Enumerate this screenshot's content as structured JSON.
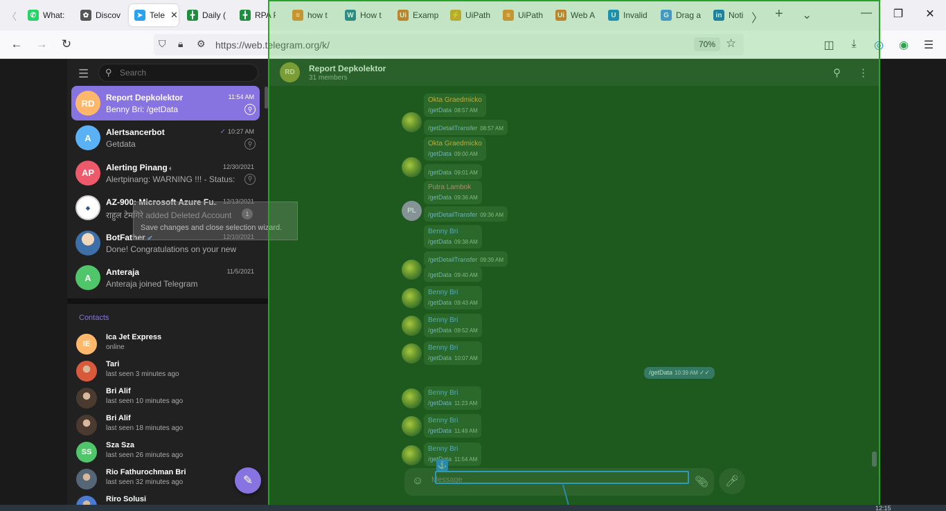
{
  "browser": {
    "tabs": [
      {
        "label": "What:",
        "icon": "whatsapp-icon",
        "color": "#25d366",
        "glyph": "✆"
      },
      {
        "label": "Discov",
        "icon": "discover-icon",
        "color": "#555555",
        "glyph": "✿"
      },
      {
        "label": "Tele",
        "icon": "telegram-icon",
        "color": "#2aa3ef",
        "glyph": "➤",
        "active": true
      },
      {
        "label": "Daily (",
        "icon": "sheets-icon",
        "color": "#1e8e3e",
        "glyph": "╋"
      },
      {
        "label": "RPA P",
        "icon": "sheets-icon",
        "color": "#1e8e3e",
        "glyph": "╋"
      },
      {
        "label": "how t",
        "icon": "stackoverflow-icon",
        "color": "#f48024",
        "glyph": "≡"
      },
      {
        "label": "How t",
        "icon": "wordpress-icon",
        "color": "#21759b",
        "glyph": "W"
      },
      {
        "label": "Examp",
        "icon": "uipath-icon",
        "color": "#e86a1f",
        "glyph": "Ui"
      },
      {
        "label": "UiPath",
        "icon": "uipath-forum-icon",
        "color": "#e0a020",
        "glyph": "⚡"
      },
      {
        "label": "UiPath",
        "icon": "stackoverflow-icon",
        "color": "#f48024",
        "glyph": "≡"
      },
      {
        "label": "Web A",
        "icon": "uipath-icon",
        "color": "#e86a1f",
        "glyph": "Ui"
      },
      {
        "label": "Invalid",
        "icon": "uipath-docs-icon",
        "color": "#0a7bd6",
        "glyph": "U"
      },
      {
        "label": "Drag a",
        "icon": "google-icon",
        "color": "#4285f4",
        "glyph": "G"
      },
      {
        "label": "Noti",
        "icon": "linkedin-icon",
        "color": "#0a66c2",
        "glyph": "in"
      }
    ],
    "url": "https://web.telegram.org/k/",
    "zoom": "70%"
  },
  "sidebar": {
    "search_placeholder": "Search",
    "chats": [
      {
        "initials": "RD",
        "name": "Report Depkolektor",
        "time": "11:54 AM",
        "preview": "Benny Bri: /getData",
        "color": "#ffb86b",
        "active": true,
        "indicator": "pin"
      },
      {
        "initials": "A",
        "name": "Alertsancerbot",
        "time": "10:27 AM",
        "preview": "Getdata",
        "color": "#5bb1f5",
        "indicator": "pin",
        "read": true
      },
      {
        "initials": "AP",
        "name": "Alerting Pinang",
        "time": "12/30/2021",
        "preview": "Alertpinang: WARNING !!! - Status: PA...",
        "color": "#ec5a6b",
        "indicator": "pin",
        "muted": true
      },
      {
        "initials": "",
        "name": "AZ-900: Microsoft Azure Fu...",
        "time": "12/13/2021",
        "preview": "राहुल टेमगिरे added Deleted Account",
        "color": "#ffffff",
        "indicator": "badge",
        "unread": "1",
        "muted": true
      },
      {
        "initials": "",
        "name": "BotFather",
        "time": "12/10/2021",
        "preview": "Done! Congratulations on your new bot. Y...",
        "color": "#3d6fa8",
        "verified": true
      },
      {
        "initials": "A",
        "name": "Anteraja",
        "time": "11/5/2021",
        "preview": "Anteraja joined Telegram",
        "color": "#50c56a"
      }
    ],
    "contacts_title": "Contacts",
    "contacts": [
      {
        "initials": "IE",
        "name": "Ica Jet Express",
        "status": "online",
        "color": "#ffb86b"
      },
      {
        "initials": "",
        "name": "Tari",
        "status": "last seen 3 minutes ago",
        "color": "#d85a3a"
      },
      {
        "initials": "",
        "name": "Bri Alif",
        "status": "last seen 10 minutes ago",
        "color": "#4a3a30"
      },
      {
        "initials": "",
        "name": "Bri Alif",
        "status": "last seen 18 minutes ago",
        "color": "#4a3a30"
      },
      {
        "initials": "SS",
        "name": "Sza Sza",
        "status": "last seen 26 minutes ago",
        "color": "#50c56a"
      },
      {
        "initials": "",
        "name": "Rio Fathurochman Bri",
        "status": "last seen 32 minutes ago",
        "color": "#556677"
      },
      {
        "initials": "",
        "name": "Riro Solusi",
        "status": "",
        "color": "#4a7bd0"
      }
    ]
  },
  "tooltip": {
    "text": "Save changes and close selection wizard."
  },
  "chat": {
    "title": "Report Depkolektor",
    "subtitle": "31 members",
    "avatar_initials": "RD",
    "composer_placeholder": "Message",
    "colors": {
      "sender_okta": "#e6a23a",
      "sender_putra": "#c97a7a",
      "sender_benny": "#5aa0d8",
      "link": "#7ea8d8"
    },
    "messages": [
      {
        "kind": "in",
        "sender": "Okta Graedmicko",
        "sender_color": "#e6a23a",
        "text": "/getData",
        "time": "08:57 AM"
      },
      {
        "kind": "in",
        "text": "/getDetailTransfer",
        "time": "08:57 AM"
      },
      {
        "kind": "in",
        "sender": "Okta Graedmicko",
        "sender_color": "#e6a23a",
        "text": "/getData",
        "time": "09:00 AM"
      },
      {
        "kind": "in",
        "text": "/getData",
        "time": "09:01 AM"
      },
      {
        "kind": "in",
        "sender": "Putra Lambok",
        "sender_color": "#c97a7a",
        "text": "/getData",
        "time": "09:36 AM"
      },
      {
        "kind": "in",
        "text": "/getDetailTransfer",
        "time": "09:36 AM",
        "avatar": "PL"
      },
      {
        "kind": "in",
        "sender": "Benny Bri",
        "sender_color": "#5aa0d8",
        "text": "/getData",
        "time": "09:38 AM"
      },
      {
        "kind": "in",
        "text": "/getDetailTransfer",
        "time": "09:39 AM"
      },
      {
        "kind": "in",
        "text": "/getData",
        "time": "09:40 AM"
      },
      {
        "kind": "in",
        "sender": "Benny Bri",
        "sender_color": "#5aa0d8",
        "text": "/getData",
        "time": "09:43 AM"
      },
      {
        "kind": "in",
        "sender": "Benny Bri",
        "sender_color": "#5aa0d8",
        "text": "/getData",
        "time": "09:52 AM"
      },
      {
        "kind": "in",
        "sender": "Benny Bri",
        "sender_color": "#5aa0d8",
        "text": "/getData",
        "time": "10:07 AM"
      },
      {
        "kind": "out",
        "text": "/getData",
        "time": "10:39 AM"
      },
      {
        "kind": "in",
        "sender": "Benny Bri",
        "sender_color": "#5aa0d8",
        "text": "/getData",
        "time": "11:23 AM"
      },
      {
        "kind": "in",
        "sender": "Benny Bri",
        "sender_color": "#5aa0d8",
        "text": "/getData",
        "time": "11:49 AM"
      },
      {
        "kind": "in",
        "sender": "Benny Bri",
        "sender_color": "#5aa0d8",
        "text": "/getData",
        "time": "11:54 AM"
      }
    ]
  },
  "taskbar": {
    "clock": "12:15"
  }
}
